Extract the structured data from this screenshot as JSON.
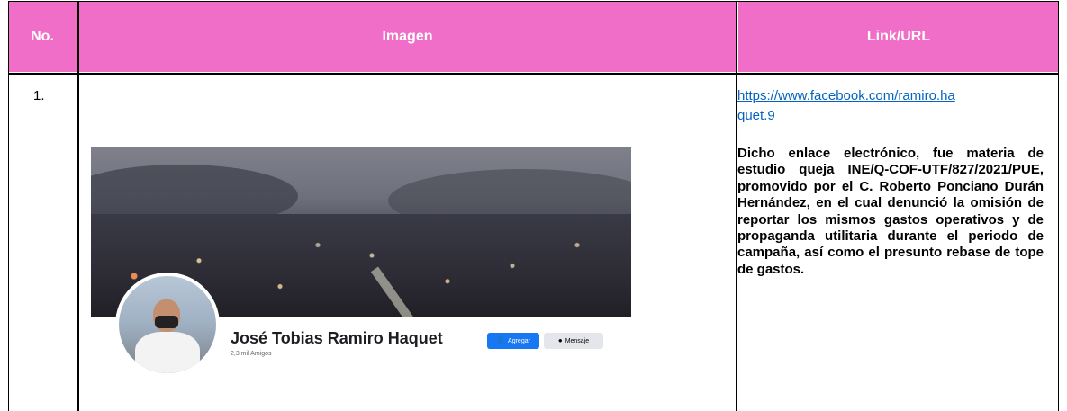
{
  "table": {
    "headers": {
      "no": "No.",
      "image": "Imagen",
      "link": "Link/URL"
    },
    "header_color": "#f06ec8"
  },
  "row": {
    "number": "1.",
    "link_line1": "https://www.facebook.com/ramiro.ha",
    "link_line2": "quet.9",
    "description": "Dicho enlace electrónico, fue materia de estudio queja INE/Q-COF-UTF/827/2021/PUE, promovido por el C. Roberto Ponciano Durán Hernández, en el cual denunció la omisión de reportar los mismos gastos operativos y de propaganda utilitaria durante el periodo de campaña, así como el presunto rebase de tope de gastos."
  },
  "profile": {
    "name": "José Tobias Ramiro Haquet",
    "friends": "2,3 mil Amigos",
    "add_label": "Agregar",
    "message_label": "Mensaje",
    "add_icon": "user-plus-icon",
    "message_icon": "messenger-icon"
  }
}
